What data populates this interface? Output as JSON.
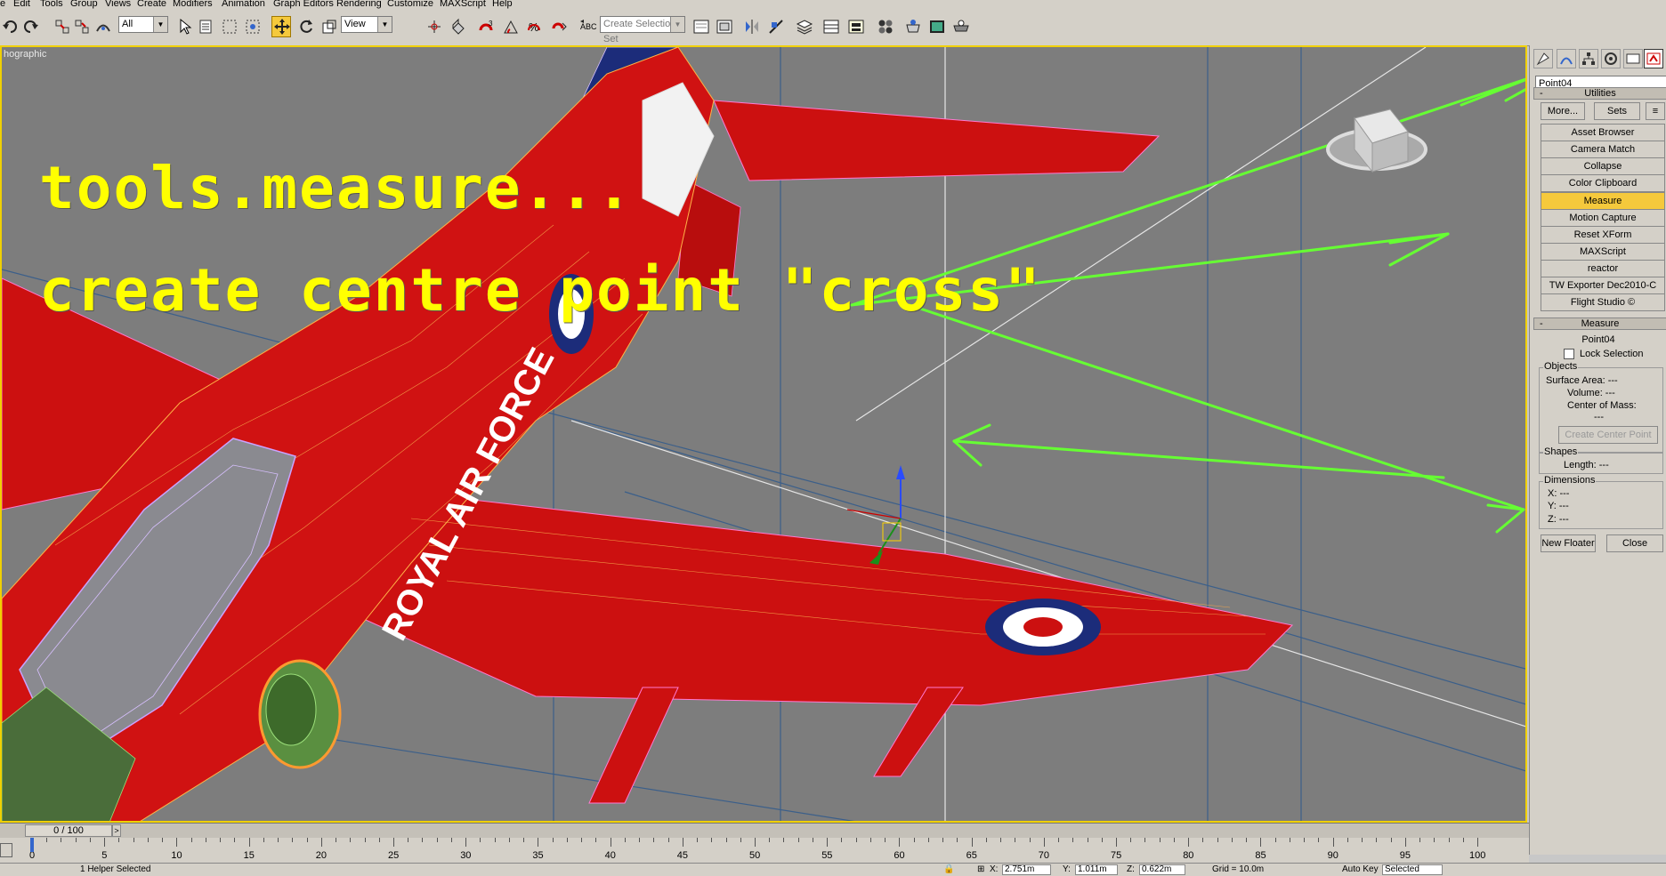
{
  "menu": [
    "e",
    "Edit",
    "Tools",
    "Group",
    "Views",
    "Create",
    "Modifiers",
    "Animation",
    "Graph Editors",
    "Rendering",
    "Customize",
    "MAXScript",
    "Help"
  ],
  "toolbar": {
    "selection_filter": "All",
    "ref_coord": "View",
    "named_selection_placeholder": "Create Selection Set"
  },
  "viewport": {
    "label": "hographic",
    "overlay_line1": "tools.measure...",
    "overlay_line2": "create centre point \"cross\"",
    "fuselage_text": "ROYAL AIR FORCE"
  },
  "command_panel": {
    "object_name": "Point04",
    "utilities": {
      "title": "Utilities",
      "more_label": "More...",
      "sets_label": "Sets",
      "items": [
        "Asset Browser",
        "Camera Match",
        "Collapse",
        "Color Clipboard",
        "Measure",
        "Motion Capture",
        "Reset XForm",
        "MAXScript",
        "reactor",
        "TW Exporter Dec2010-C",
        "Flight Studio ©"
      ],
      "highlighted": "Measure"
    },
    "measure": {
      "title": "Measure",
      "object": "Point04",
      "lock_selection": "Lock Selection",
      "objects_group": "Objects",
      "surface_area": "Surface Area:  ---",
      "volume": "Volume:  ---",
      "center_of_mass": "Center of Mass:",
      "center_of_mass_value": "---",
      "create_center_point": "Create Center Point",
      "shapes_group": "Shapes",
      "length": "Length:  ---",
      "dimensions_group": "Dimensions",
      "x": "X:  ---",
      "y": "Y:  ---",
      "z": "Z:  ---",
      "new_floater": "New Floater",
      "close": "Close"
    }
  },
  "timeline": {
    "frame": "0 / 100",
    "next": ">",
    "ticks": [
      "0",
      "5",
      "10",
      "15",
      "20",
      "25",
      "30",
      "35",
      "40",
      "45",
      "50",
      "55",
      "60",
      "65",
      "70",
      "75",
      "80",
      "85",
      "90",
      "95",
      "100"
    ]
  },
  "status": {
    "selected": "1 Helper Selected",
    "x": "2.751m",
    "y": "1.011m",
    "z": "0.622m",
    "grid": "Grid = 10.0m",
    "autokey": "Auto Key",
    "selected_dd": "Selected"
  },
  "colors": {
    "viewport_bg": "#7d7d7d",
    "aircraft_red": "#cc1010",
    "overlay_yellow": "#ffff00",
    "arrow_green": "#66ff33",
    "active_yellow": "#f5c93c"
  }
}
